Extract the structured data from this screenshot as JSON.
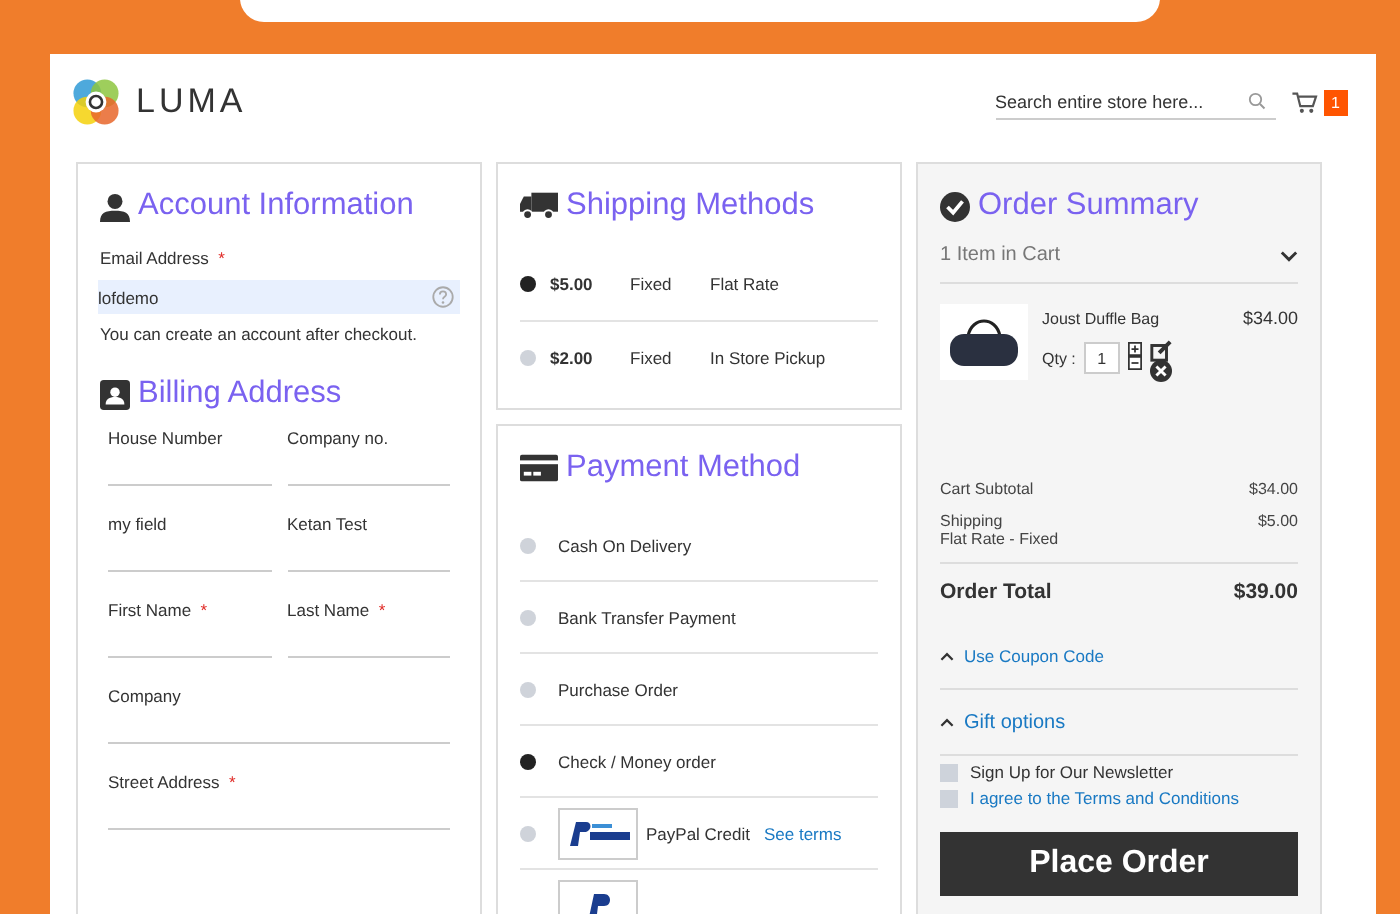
{
  "header": {
    "logo": "LUMA",
    "search": {
      "placeholder": "Search entire store here..."
    },
    "cart_count": "1"
  },
  "account": {
    "title": "Account Information",
    "email": {
      "label": "Email Address",
      "required": true,
      "value": "lofdemo"
    },
    "note": "You can create an account after checkout."
  },
  "required_mark": "*",
  "billing": {
    "title": "Billing Address",
    "rows": [
      [
        {
          "label": "House Number",
          "required": false
        },
        {
          "label": "Company no.",
          "required": false
        }
      ],
      [
        {
          "label": "my field",
          "required": false
        },
        {
          "label": "Ketan Test",
          "required": false
        }
      ],
      [
        {
          "label": "First Name",
          "required": true
        },
        {
          "label": "Last Name",
          "required": true
        }
      ],
      [
        {
          "label": "Company",
          "required": false
        }
      ],
      [
        {
          "label": "Street Address",
          "required": true
        }
      ]
    ]
  },
  "shipping": {
    "title": "Shipping Methods",
    "methods": [
      {
        "price": "$5.00",
        "type": "Fixed",
        "carrier": "Flat Rate",
        "selected": true
      },
      {
        "price": "$2.00",
        "type": "Fixed",
        "carrier": "In Store Pickup",
        "selected": false
      }
    ]
  },
  "payment": {
    "title": "Payment Method",
    "methods": [
      {
        "kind": "plain",
        "label": "Cash On Delivery",
        "selected": false
      },
      {
        "kind": "plain",
        "label": "Bank Transfer Payment",
        "selected": false
      },
      {
        "kind": "plain",
        "label": "Purchase Order",
        "selected": false
      },
      {
        "kind": "plain",
        "label": "Check / Money order",
        "selected": true
      },
      {
        "kind": "paypal-credit",
        "label": "PayPal Credit",
        "link": "See terms",
        "selected": false
      },
      {
        "kind": "paypal"
      }
    ]
  },
  "summary": {
    "title": "Order Summary",
    "items_count": "1 Item in Cart",
    "expanded": true,
    "product": {
      "name": "Joust Duffle Bag",
      "qty_label": "Qty :",
      "qty": "1",
      "price": "$34.00"
    },
    "totals": [
      {
        "label": "Cart Subtotal",
        "value": "$34.00"
      },
      {
        "label": "Shipping",
        "sub": "Flat Rate - Fixed",
        "value": "$5.00"
      }
    ],
    "order_total": {
      "label": "Order Total",
      "value": "$39.00"
    },
    "toggles": [
      "Use Coupon Code",
      "Gift options"
    ],
    "checkboxes": [
      {
        "kind": "plain",
        "label": "Sign Up for Our Newsletter",
        "checked": false
      },
      {
        "kind": "link",
        "label": "I agree to the Terms and Conditions",
        "checked": false
      }
    ],
    "button": "Place Order"
  }
}
